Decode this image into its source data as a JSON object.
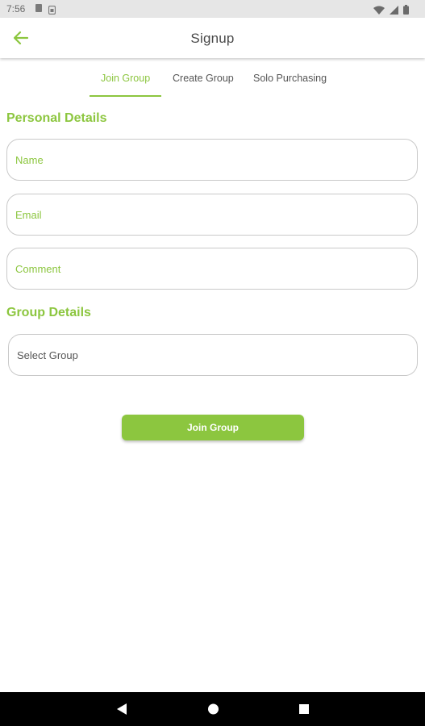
{
  "status_bar": {
    "time": "7:56",
    "left_icons": [
      "notification-icon",
      "sim-icon"
    ],
    "right_icons": [
      "wifi-icon",
      "signal-icon",
      "battery-icon"
    ]
  },
  "app_bar": {
    "back_icon": "arrow-left-icon",
    "title": "Signup"
  },
  "tabs": [
    {
      "label": "Join Group",
      "active": true
    },
    {
      "label": "Create Group",
      "active": false
    },
    {
      "label": "Solo Purchasing",
      "active": false
    }
  ],
  "personal_details": {
    "title": "Personal Details",
    "name_placeholder": "Name",
    "email_placeholder": "Email",
    "comment_placeholder": "Comment"
  },
  "group_details": {
    "title": "Group Details",
    "select_group_label": "Select Group"
  },
  "actions": {
    "join_button_label": "Join Group"
  },
  "colors": {
    "accent": "#8cc63f",
    "status_bar_bg": "#e6e6e6",
    "nav_bar_bg": "#000000"
  },
  "nav_bar": {
    "icons": [
      "back-triangle-icon",
      "home-circle-icon",
      "recents-square-icon"
    ]
  }
}
